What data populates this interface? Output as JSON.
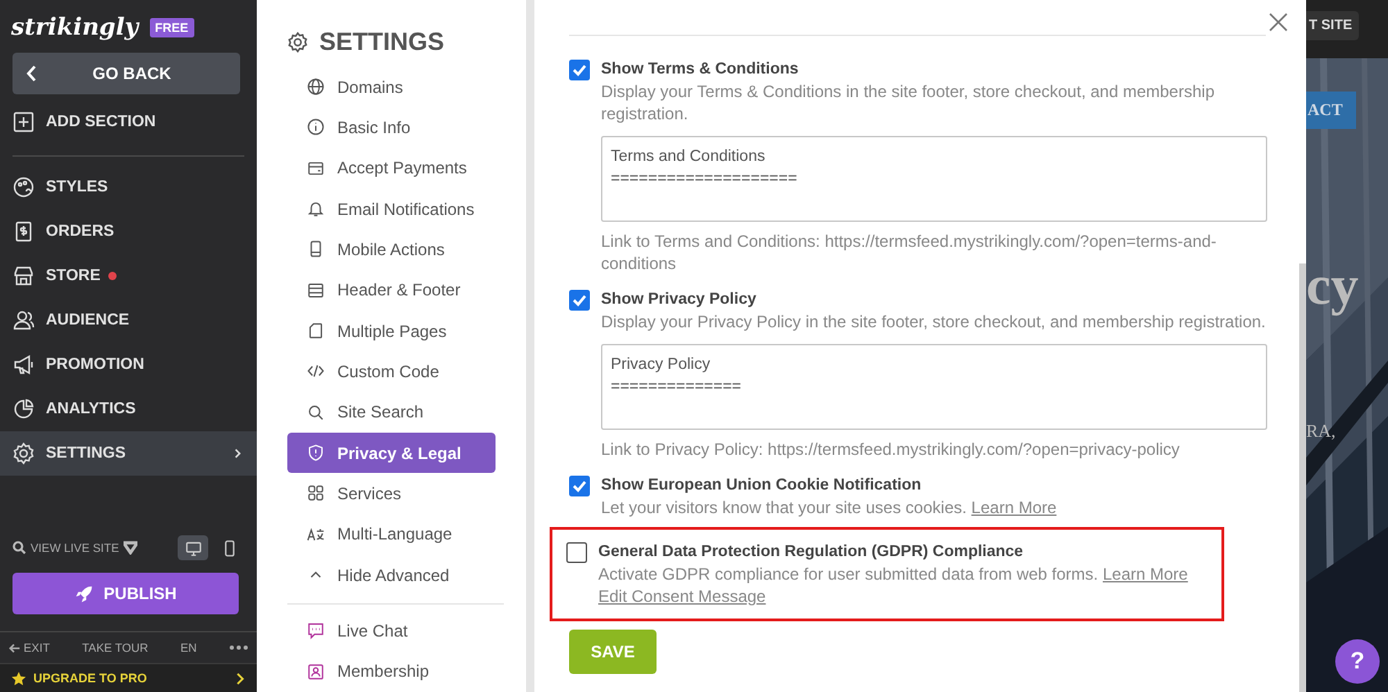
{
  "sidebar": {
    "logo": "strikingly",
    "plan_badge": "FREE",
    "back_button": "GO BACK",
    "add_section": "ADD SECTION",
    "items": [
      {
        "label": "STYLES",
        "selected": false,
        "alert": false
      },
      {
        "label": "ORDERS",
        "selected": false,
        "alert": false
      },
      {
        "label": "STORE",
        "selected": false,
        "alert": true
      },
      {
        "label": "AUDIENCE",
        "selected": false,
        "alert": false
      },
      {
        "label": "PROMOTION",
        "selected": false,
        "alert": false
      },
      {
        "label": "ANALYTICS",
        "selected": false,
        "alert": false
      },
      {
        "label": "SETTINGS",
        "selected": true,
        "alert": false
      }
    ],
    "view_live_site": "VIEW LIVE SITE",
    "devices": [
      {
        "selected": true
      },
      {
        "selected": false
      }
    ],
    "publish_button": "PUBLISH",
    "footer_links": [
      "EXIT",
      "TAKE TOUR",
      "EN"
    ],
    "upgrade": "UPGRADE TO PRO"
  },
  "settings_menu": {
    "title": "SETTINGS",
    "items": [
      {
        "label": "Domains",
        "selected": false
      },
      {
        "label": "Basic Info",
        "selected": false
      },
      {
        "label": "Accept Payments",
        "selected": false
      },
      {
        "label": "Email Notifications",
        "selected": false
      },
      {
        "label": "Mobile Actions",
        "selected": false
      },
      {
        "label": "Header & Footer",
        "selected": false
      },
      {
        "label": "Multiple Pages",
        "selected": false
      },
      {
        "label": "Custom Code",
        "selected": false
      },
      {
        "label": "Site Search",
        "selected": false
      },
      {
        "label": "Privacy & Legal",
        "selected": true
      },
      {
        "label": "Services",
        "selected": false
      },
      {
        "label": "Multi-Language",
        "selected": false
      },
      {
        "label": "Hide Advanced",
        "selected": false
      }
    ],
    "apps": [
      {
        "label": "Live Chat"
      },
      {
        "label": "Membership"
      }
    ]
  },
  "privacy_legal": {
    "options": [
      {
        "title": "Show Terms & Conditions",
        "description": "Display your Terms & Conditions in the site footer, store checkout, and membership registration.",
        "checked": true,
        "highlighted": false,
        "text_area": "Terms and Conditions\n====================",
        "link_note": "Link to Terms and Conditions: https://termsfeed.mystrikingly.com/?open=terms-and-conditions"
      },
      {
        "title": "Show Privacy Policy",
        "description": "Display your Privacy Policy in the site footer, store checkout, and membership registration.",
        "checked": true,
        "highlighted": false,
        "text_area": "Privacy Policy\n==============",
        "link_note": "Link to Privacy Policy: https://termsfeed.mystrikingly.com/?open=privacy-policy"
      },
      {
        "title": "Show European Union Cookie Notification",
        "description": "Let your visitors know that your site uses cookies.",
        "learn_more": "Learn More",
        "checked": true,
        "highlighted": false
      },
      {
        "title": "General Data Protection Regulation (GDPR) Compliance",
        "description": "Activate GDPR compliance for user submitted data from web forms.",
        "learn_more": "Learn More",
        "edit_link": "Edit Consent Message",
        "checked": false,
        "highlighted": true
      }
    ],
    "save_button": "SAVE"
  },
  "preview": {
    "top_button": "T SITE",
    "nav_button": "ACT",
    "heading": "cy",
    "text": "RA,",
    "help_button": "?"
  }
}
